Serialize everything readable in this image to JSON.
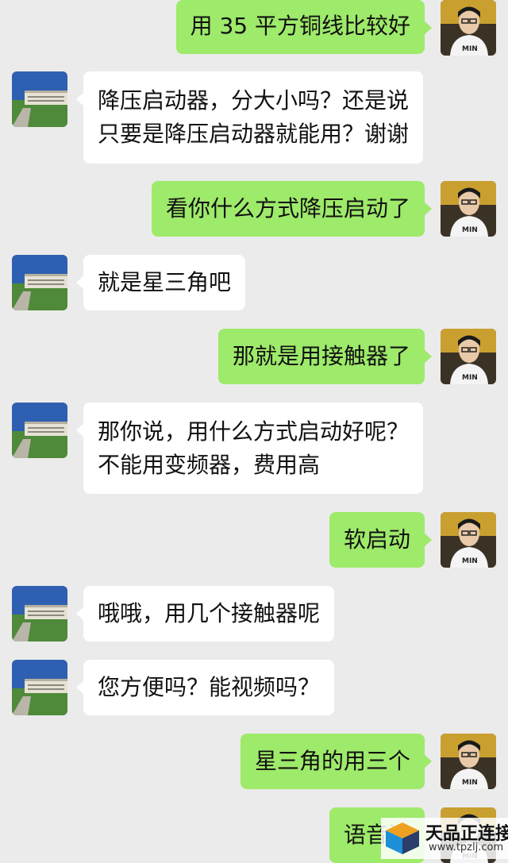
{
  "conversation": {
    "messages": [
      {
        "side": "out",
        "lines": [
          "用 35 平方铜线比较好"
        ]
      },
      {
        "side": "in",
        "lines": [
          "降压启动器，分大小吗？还是说",
          "只要是降压启动器就能用？谢谢"
        ]
      },
      {
        "side": "out",
        "lines": [
          "看你什么方式降压启动了"
        ]
      },
      {
        "side": "in",
        "lines": [
          "就是星三角吧"
        ]
      },
      {
        "side": "out",
        "lines": [
          "那就是用接触器了"
        ]
      },
      {
        "side": "in",
        "lines": [
          "那你说，用什么方式启动好呢？",
          "不能用变频器，费用高"
        ]
      },
      {
        "side": "out",
        "lines": [
          "软启动"
        ]
      },
      {
        "side": "in",
        "lines": [
          "哦哦，用几个接触器呢"
        ]
      },
      {
        "side": "in",
        "lines": [
          "您方便吗？能视频吗？"
        ]
      },
      {
        "side": "out",
        "lines": [
          "星三角的用三个"
        ]
      },
      {
        "side": "out",
        "lines": [
          "语音说"
        ]
      }
    ]
  },
  "watermark": {
    "title": "天品正连接",
    "url": "www.tpzlj.com"
  },
  "colors": {
    "background": "#ebebeb",
    "incoming_bubble": "#ffffff",
    "outgoing_bubble": "#9eea6a"
  }
}
